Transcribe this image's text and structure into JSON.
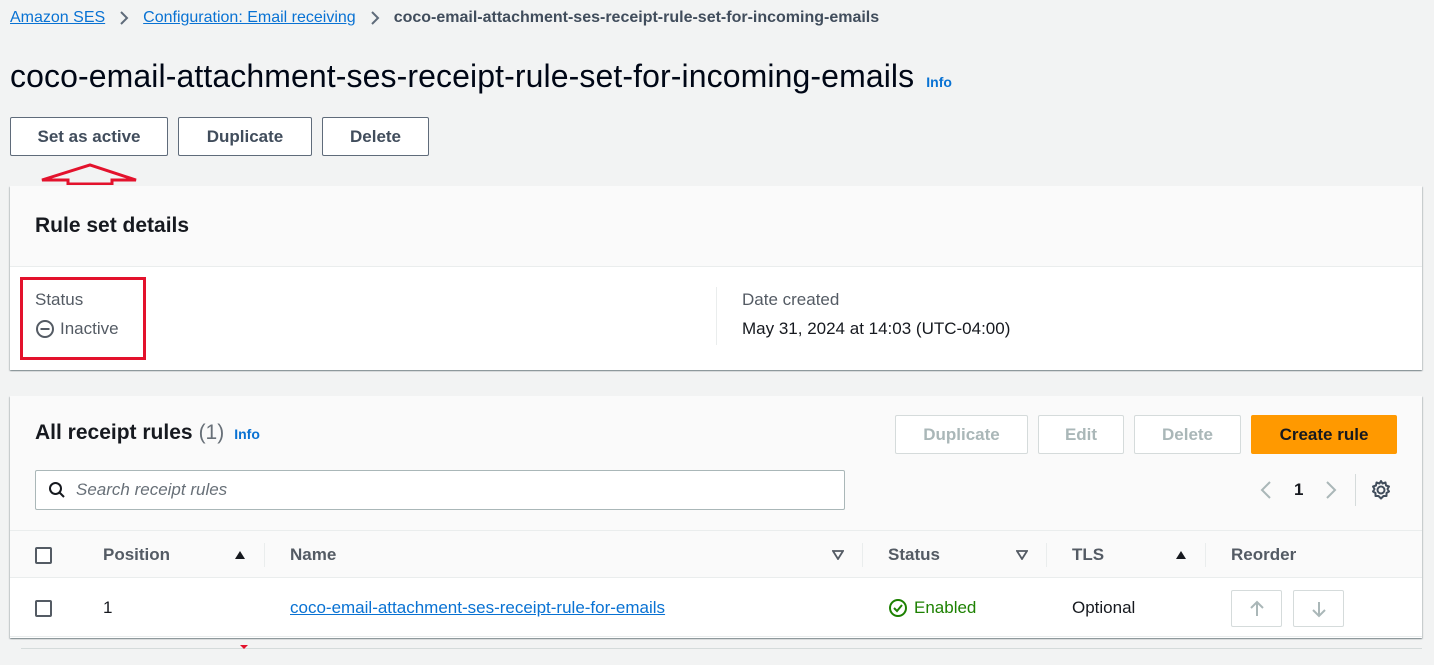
{
  "breadcrumb": {
    "items": [
      "Amazon SES",
      "Configuration: Email receiving"
    ],
    "current": "coco-email-attachment-ses-receipt-rule-set-for-incoming-emails"
  },
  "header": {
    "title": "coco-email-attachment-ses-receipt-rule-set-for-incoming-emails",
    "info": "Info"
  },
  "actions": {
    "set_active": "Set as active",
    "duplicate": "Duplicate",
    "delete": "Delete"
  },
  "details": {
    "title": "Rule set details",
    "status_label": "Status",
    "status_value": "Inactive",
    "date_label": "Date created",
    "date_value": "May 31, 2024 at 14:03 (UTC-04:00)"
  },
  "rules": {
    "title": "All receipt rules",
    "count": "(1)",
    "info": "Info",
    "buttons": {
      "duplicate": "Duplicate",
      "edit": "Edit",
      "delete": "Delete",
      "create": "Create rule"
    },
    "search_placeholder": "Search receipt rules",
    "page": "1",
    "columns": [
      "Position",
      "Name",
      "Status",
      "TLS",
      "Reorder"
    ],
    "rows": [
      {
        "position": "1",
        "name": "coco-email-attachment-ses-receipt-rule-for-emails",
        "status": "Enabled",
        "tls": "Optional"
      }
    ]
  },
  "colors": {
    "link": "#0972d3",
    "primary_button": "#ff9900",
    "success": "#1d8102",
    "annotation": "#e3122c"
  }
}
